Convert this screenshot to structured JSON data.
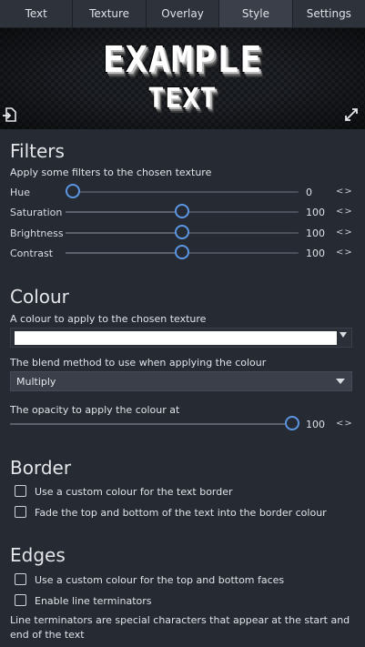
{
  "tabs": [
    "Text",
    "Texture",
    "Overlay",
    "Style",
    "Settings"
  ],
  "active_tab": "Style",
  "preview": {
    "line1": "EXAMPLE",
    "line2": "TEXT",
    "left_icon": "export-icon",
    "right_icon": "expand-icon"
  },
  "filters": {
    "title": "Filters",
    "description": "Apply some filters to the chosen texture",
    "items": [
      {
        "label": "Hue",
        "value": "0"
      },
      {
        "label": "Saturation",
        "value": "100"
      },
      {
        "label": "Brightness",
        "value": "100"
      },
      {
        "label": "Contrast",
        "value": "100"
      }
    ],
    "arrows": "<>"
  },
  "colour": {
    "title": "Colour",
    "description": "A colour to apply to the chosen texture",
    "swatch_color": "#ffffff",
    "blend_label": "The blend method to use when applying the colour",
    "blend_value": "Multiply",
    "opacity_label": "The opacity to apply the colour at",
    "opacity_value": "100",
    "arrows": "<>"
  },
  "border": {
    "title": "Border",
    "options": [
      "Use a custom colour for the text border",
      "Fade the top and bottom of the text into the border colour"
    ]
  },
  "edges": {
    "title": "Edges",
    "options": [
      "Use a custom colour for the top and bottom faces",
      "Enable line terminators"
    ],
    "note": "Line terminators are special characters that appear at the start and end of the text"
  },
  "colors": {
    "background": "#262a33",
    "accent": "#5b96e3",
    "tab_active": "#3a3f4a"
  }
}
